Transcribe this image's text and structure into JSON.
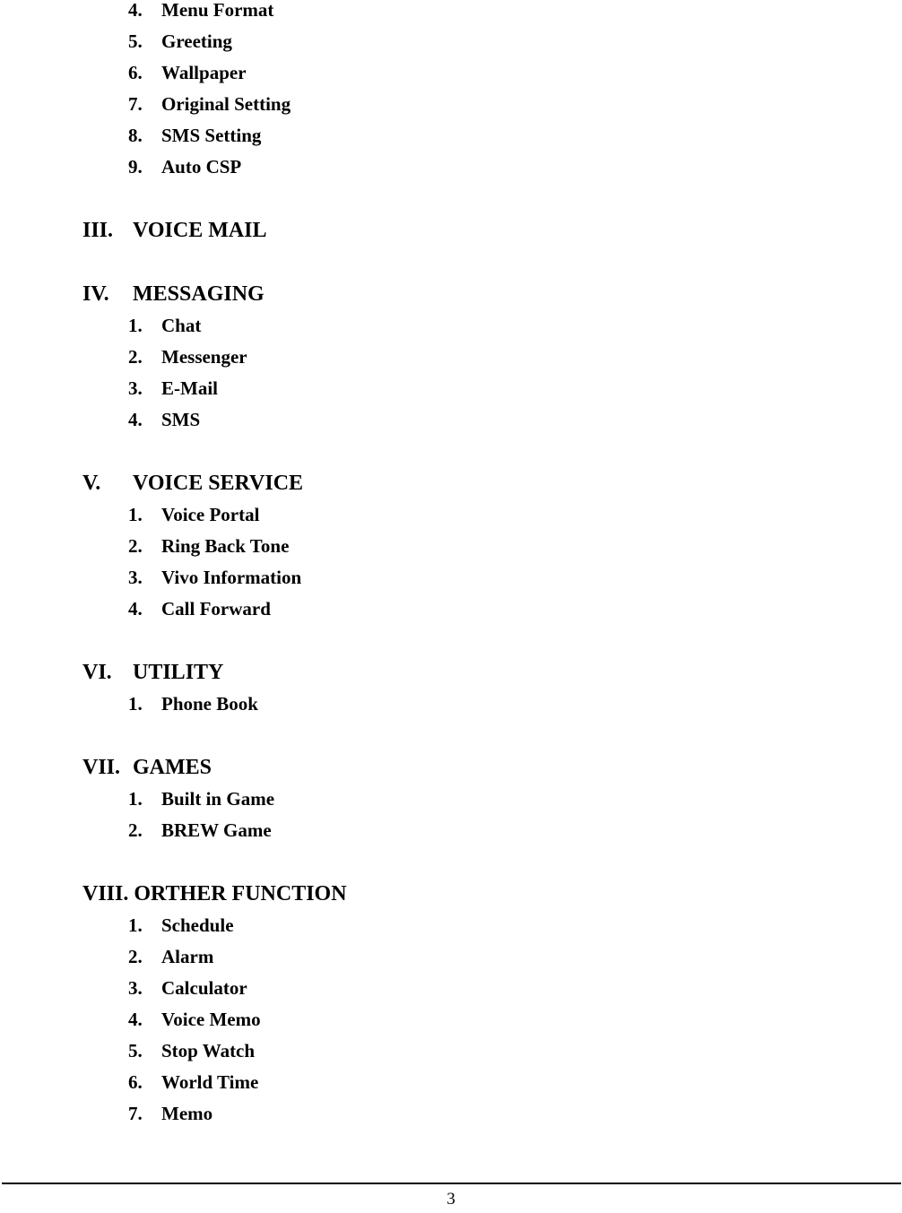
{
  "page": {
    "number": "3",
    "background_color": "#ffffff",
    "text_color": "#000000"
  },
  "continued_list": {
    "items": [
      {
        "num": "4.",
        "label": "Menu Format"
      },
      {
        "num": "5.",
        "label": "Greeting"
      },
      {
        "num": "6.",
        "label": "Wallpaper"
      },
      {
        "num": "7.",
        "label": "Original Setting"
      },
      {
        "num": "8.",
        "label": "SMS Setting"
      },
      {
        "num": "9.",
        "label": "Auto CSP"
      }
    ]
  },
  "sections": [
    {
      "num": "III.",
      "label": "VOICE MAIL",
      "items": []
    },
    {
      "num": "IV.",
      "label": "MESSAGING",
      "items": [
        {
          "num": "1.",
          "label": "Chat"
        },
        {
          "num": "2.",
          "label": "Messenger"
        },
        {
          "num": "3.",
          "label": "E-Mail"
        },
        {
          "num": "4.",
          "label": "SMS"
        }
      ]
    },
    {
      "num": "V.",
      "label": "VOICE SERVICE",
      "items": [
        {
          "num": "1.",
          "label": "Voice Portal"
        },
        {
          "num": "2.",
          "label": "Ring Back Tone"
        },
        {
          "num": "3.",
          "label": "Vivo Information"
        },
        {
          "num": "4.",
          "label": "Call Forward"
        }
      ]
    },
    {
      "num": "VI.",
      "label": "UTILITY",
      "items": [
        {
          "num": "1.",
          "label": "Phone Book"
        }
      ]
    },
    {
      "num": "VII.",
      "label": "GAMES",
      "items": [
        {
          "num": "1.",
          "label": "Built in Game"
        },
        {
          "num": "2.",
          "label": "BREW Game"
        }
      ]
    },
    {
      "num": "VIII.",
      "label": "ORTHER FUNCTION",
      "items": [
        {
          "num": "1.",
          "label": "Schedule"
        },
        {
          "num": "2.",
          "label": "Alarm"
        },
        {
          "num": "3.",
          "label": "Calculator"
        },
        {
          "num": "4.",
          "label": "Voice Memo"
        },
        {
          "num": "5.",
          "label": "Stop Watch"
        },
        {
          "num": "6.",
          "label": "World Time"
        },
        {
          "num": "7.",
          "label": "Memo"
        }
      ]
    }
  ]
}
